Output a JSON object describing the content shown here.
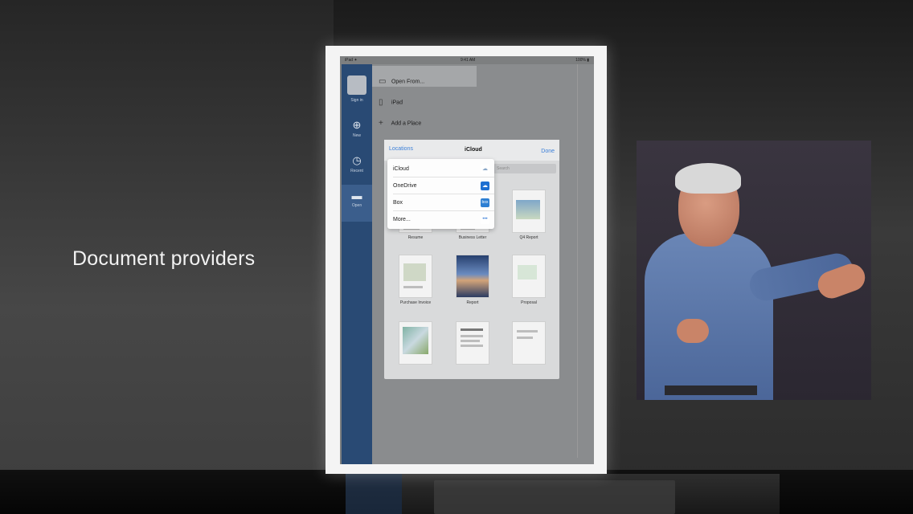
{
  "caption": "Document providers",
  "ipad": {
    "status": {
      "carrier": "iPad ✦",
      "time": "9:41 AM",
      "battery": "100% ▮"
    },
    "rail": [
      {
        "icon": "person-icon",
        "label": "Sign in"
      },
      {
        "icon": "new-icon",
        "label": "New",
        "glyph": "⊕"
      },
      {
        "icon": "clock-icon",
        "label": "Recent",
        "glyph": "◷"
      },
      {
        "icon": "folder-icon",
        "label": "Open",
        "glyph": "▬"
      }
    ],
    "places": {
      "open_from": "Open From...",
      "ipad": "iPad",
      "add_place": "Add a Place"
    },
    "sheet": {
      "left": "Locations",
      "title": "iCloud",
      "right": "Done",
      "search_placeholder": "Search"
    },
    "providers": [
      {
        "label": "iCloud",
        "badge": "☁",
        "color": "#ffffff",
        "badge_text_color": "#8aa7c8"
      },
      {
        "label": "OneDrive",
        "badge": "☁",
        "color": "#1e6fd1",
        "badge_text_color": "#ffffff"
      },
      {
        "label": "Box",
        "badge": "box",
        "color": "#2d7fd3",
        "badge_text_color": "#ffffff"
      },
      {
        "label": "More...",
        "badge": "•••",
        "color": "#ffffff",
        "badge_text_color": "#3b7fd8"
      }
    ],
    "documents": [
      {
        "label": "Resume"
      },
      {
        "label": "Business Letter"
      },
      {
        "label": "Q4 Report"
      },
      {
        "label": "Purchase Invoice"
      },
      {
        "label": "Report"
      },
      {
        "label": "Proposal"
      },
      {
        "label": ""
      },
      {
        "label": ""
      },
      {
        "label": ""
      }
    ]
  },
  "colors": {
    "rail": "#294a74",
    "accent": "#3b7fd8"
  }
}
